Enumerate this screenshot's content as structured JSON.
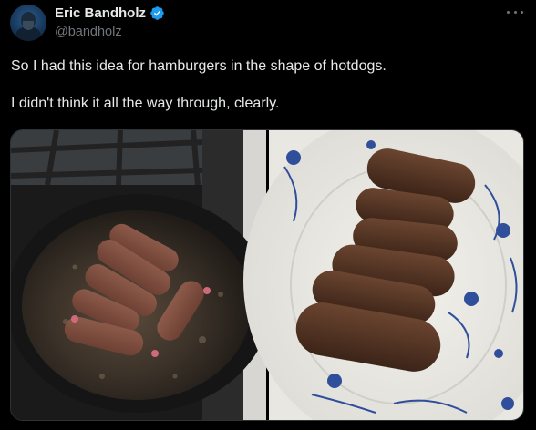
{
  "author": {
    "display_name": "Eric Bandholz",
    "handle": "@bandholz",
    "verified": true,
    "avatar_icon": "user-avatar"
  },
  "menu_icon": "more-horizontal-icon",
  "tweet": {
    "paragraphs": [
      "So I had this idea for hamburgers in the shape of hotdogs.",
      "I didn't think it all the way through, clearly."
    ]
  },
  "media": {
    "images": [
      "pan-photo",
      "plate-photo"
    ]
  },
  "colors": {
    "background": "#000000",
    "text_primary": "#e7e9ea",
    "text_secondary": "#71767b",
    "verified_blue": "#1d9bf0"
  }
}
